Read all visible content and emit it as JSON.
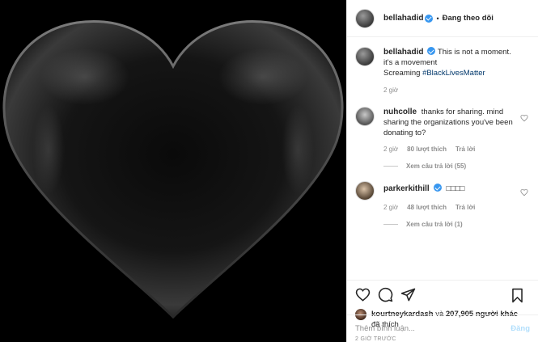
{
  "header": {
    "username": "bellahadid",
    "separator": "•",
    "follow_status": "Đang theo dõi"
  },
  "caption": {
    "username": "bellahadid",
    "text_line1": "This is not a moment.",
    "text_line2": "it's a movement",
    "text_line3": "Screaming ",
    "hashtag": "#BlackLivesMatter",
    "time": "2 giờ"
  },
  "comments": [
    {
      "username": "nuhcolle",
      "text": "thanks for sharing. mind sharing the organizations you've been donating to?",
      "time": "2 giờ",
      "likes": "80 lượt thích",
      "reply": "Trả lời",
      "view_replies": "Xem câu trả lời (55)"
    },
    {
      "username": "parkerkithill",
      "text": "□□□□",
      "time": "2 giờ",
      "likes": "48 lượt thích",
      "reply": "Trả lời",
      "view_replies": "Xem câu trả lời (1)"
    }
  ],
  "likes_summary": {
    "first_user": "kourtneykardash",
    "connector": " và ",
    "others": "207,905 người khác",
    "suffix": "đã thích"
  },
  "posted_time": "2 GIỜ TRƯỚC",
  "add_comment": {
    "placeholder": "Thêm bình luận...",
    "post_label": "Đăng"
  },
  "colors": {
    "verified": "#3897f0",
    "hashtag": "#00376b",
    "muted": "#8e8e8e",
    "post_button_disabled": "#b2dffc"
  },
  "icons": [
    "heart-icon",
    "comment-icon",
    "share-icon",
    "bookmark-icon",
    "verified-badge-icon"
  ]
}
